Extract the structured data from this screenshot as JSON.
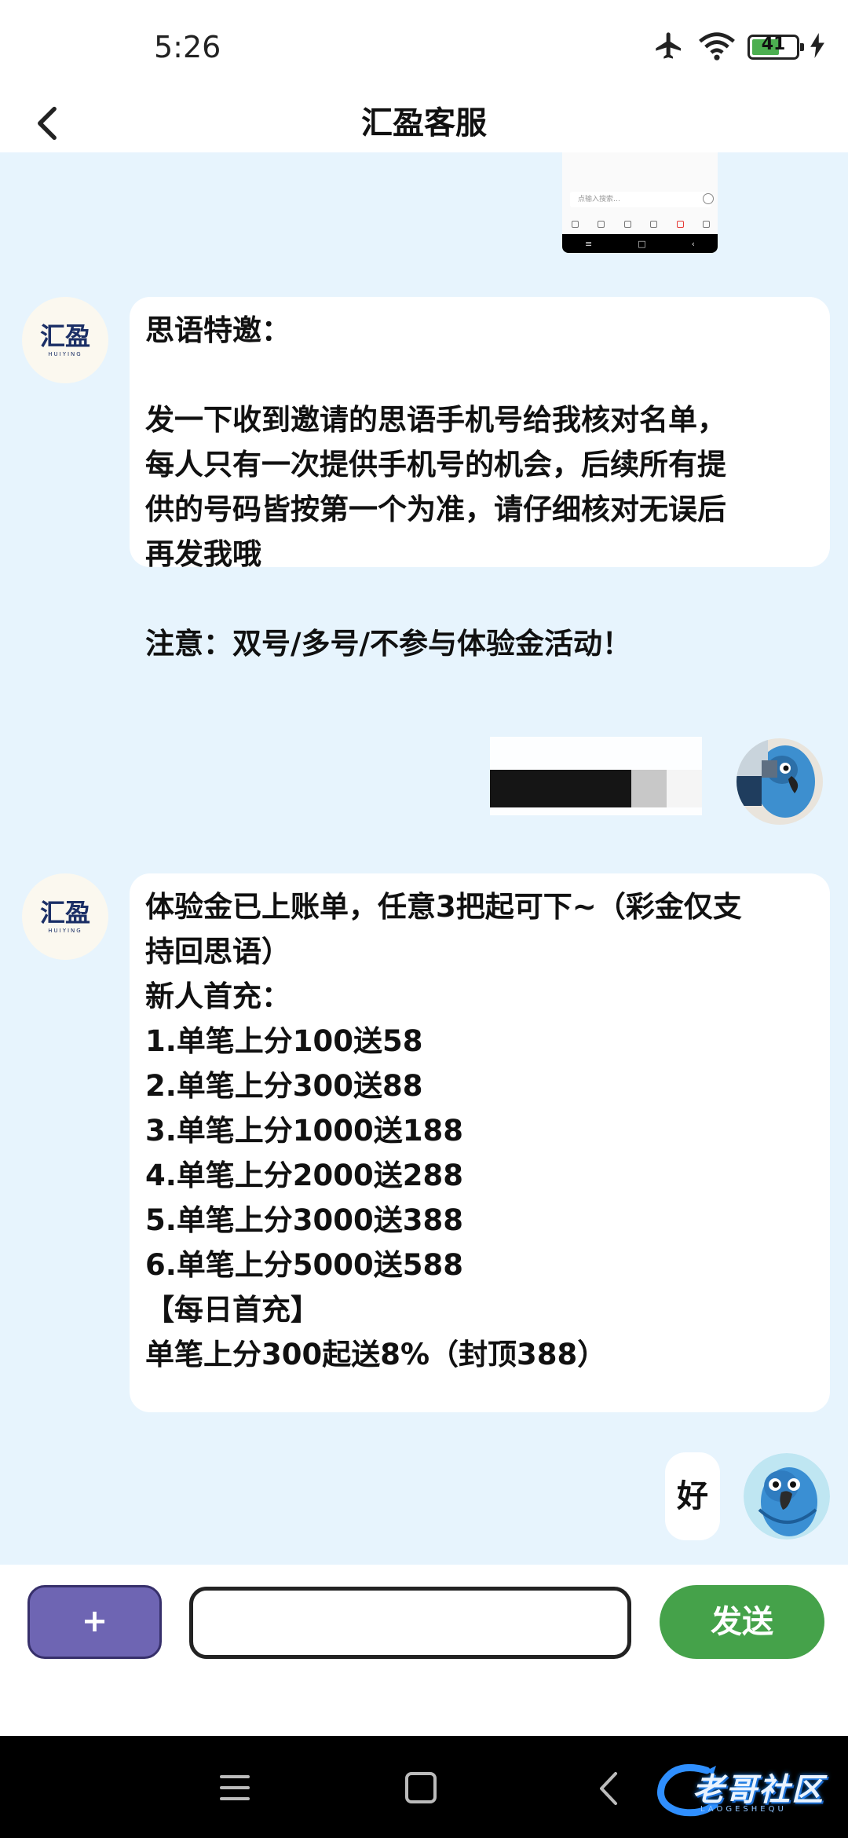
{
  "status_bar": {
    "time": "5:26",
    "battery_level": "41"
  },
  "header": {
    "title": "汇盈客服"
  },
  "agent": {
    "logo_text": "汇盈",
    "logo_subtext": "HUIYING"
  },
  "thumbnail": {
    "input_placeholder": "点输入搜索…"
  },
  "messages": [
    {
      "from": "agent",
      "lines": [
        "思语特邀：",
        "",
        "发一下收到邀请的思语手机号给我核对名单，",
        "每人只有一次提供手机号的机会，后续所有提",
        "供的号码皆按第一个为准，请仔细核对无误后",
        "再发我哦",
        "",
        "注意：双号/多号/不参与体验金活动！"
      ]
    },
    {
      "from": "agent",
      "lines": [
        "体验金已上账单，任意3把起可下~（彩金仅支",
        "持回思语）",
        "新人首充：",
        "1.单笔上分100送58",
        "2.单笔上分300送88",
        "3.单笔上分1000送188",
        "4.单笔上分2000送288",
        "5.单笔上分3000送388",
        "6.单笔上分5000送588",
        "【每日首充】",
        "单笔上分300起送8%（封顶388）"
      ]
    },
    {
      "from": "user",
      "text": "好"
    }
  ],
  "input_bar": {
    "plus_label": "+",
    "input_value": "",
    "send_label": "发送"
  },
  "watermark": {
    "text": "老哥社区",
    "subtext": "LAOGESHEQU"
  },
  "colors": {
    "chat_background": "#e7f4fd",
    "plus_button": "#6e65b3",
    "send_button": "#45a24a",
    "logo": "#1b2f66"
  }
}
